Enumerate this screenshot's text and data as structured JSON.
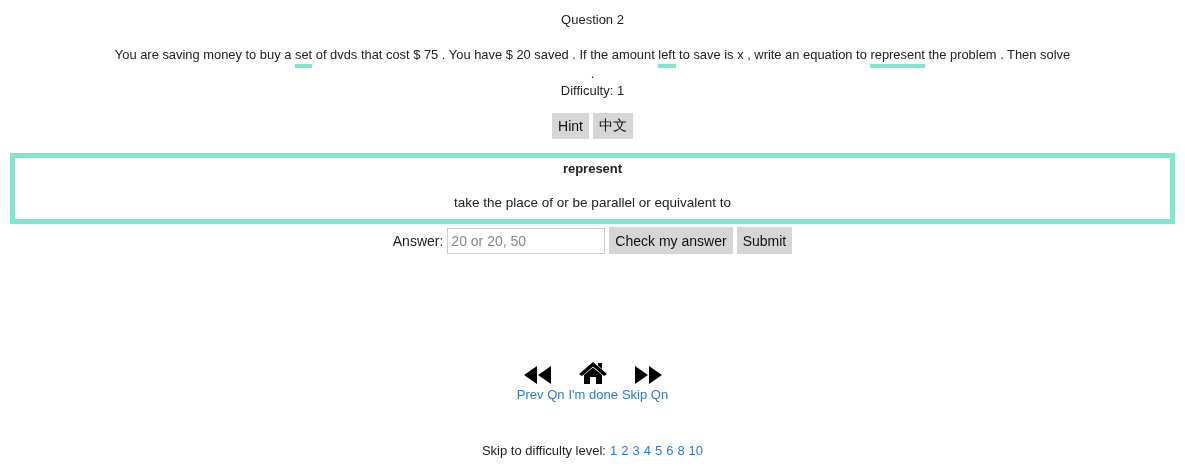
{
  "title": "Question 2",
  "question": [
    {
      "text": "You are saving money to buy a ",
      "vocab": false
    },
    {
      "text": "set",
      "vocab": true
    },
    {
      "text": " of dvds that cost $ 75 . You have $ 20 saved . If the amount ",
      "vocab": false
    },
    {
      "text": "left",
      "vocab": true
    },
    {
      "text": " to save is x , write an equation to ",
      "vocab": false
    },
    {
      "text": "represent",
      "vocab": true
    },
    {
      "text": " the problem . Then solve",
      "vocab": false
    }
  ],
  "question_end": ".",
  "difficulty": "Difficulty: 1",
  "buttons": [
    "Hint",
    "中文"
  ],
  "definition": {
    "word": "represent",
    "meaning": "take the place of or be parallel or equivalent to"
  },
  "answer": {
    "label": "Answer:",
    "placeholder": "20 or 20, 50",
    "buttons": [
      "Check my answer",
      "Submit"
    ]
  },
  "nav": [
    {
      "kind": "prev",
      "label": "Prev Qn"
    },
    {
      "kind": "home",
      "label": "I'm done"
    },
    {
      "kind": "next",
      "label": "Skip Qn"
    }
  ],
  "levels": {
    "label": "Skip to difficulty level:",
    "items": [
      "1",
      "2",
      "3",
      "4",
      "5",
      "6",
      "8",
      "10"
    ]
  }
}
